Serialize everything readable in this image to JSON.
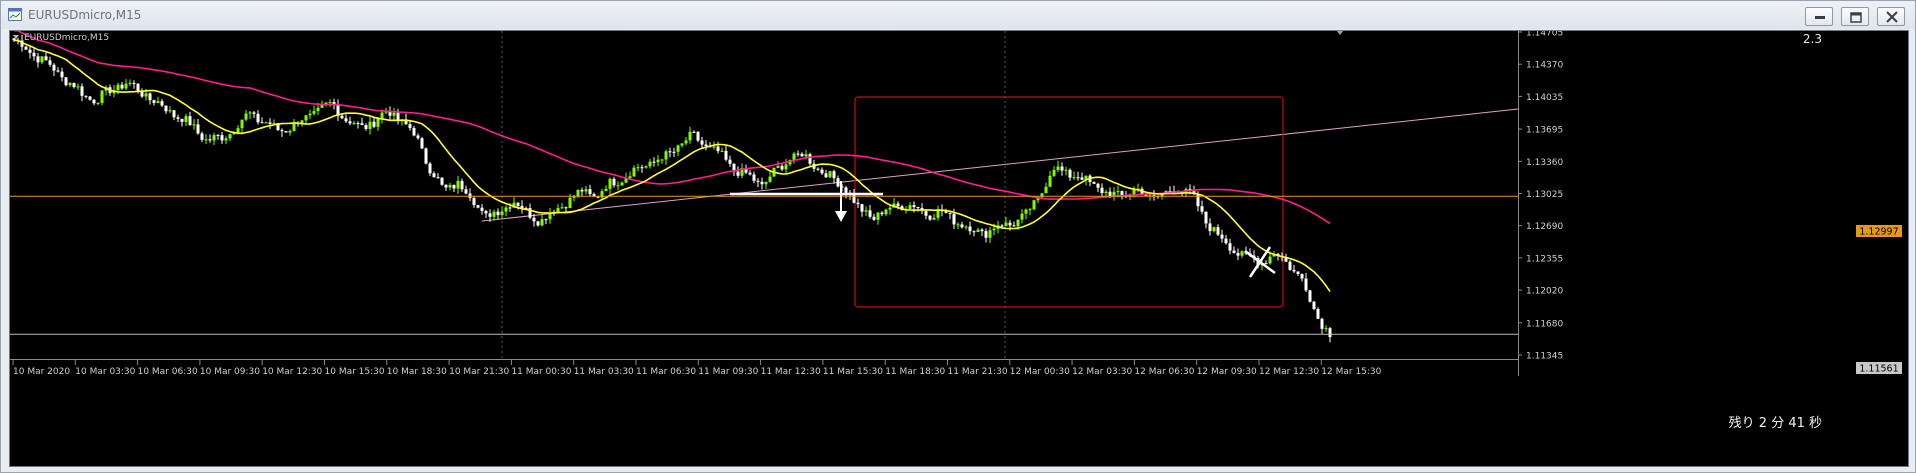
{
  "window": {
    "title": "EURUSDmicro,M15",
    "icon": "chart-window-icon"
  },
  "window_buttons": [
    {
      "name": "minimize-button",
      "icon": "minimize-icon"
    },
    {
      "name": "restore-button",
      "icon": "restore-icon"
    },
    {
      "name": "close-button",
      "icon": "close-icon"
    }
  ],
  "chart": {
    "symbol_label": "EURUSDmicro,M15",
    "corner_value": "2.3",
    "countdown": "残り 2 分 41 秒",
    "price_line_label": "1.12997",
    "bid_line_label": "1.11561",
    "colors": {
      "background": "#000000",
      "bull": "#7CFC00",
      "bear": "#FFFFFF",
      "ma_fast": "#FFFF33",
      "ma_slow": "#FF1E8C",
      "price_line": "#E39A14",
      "box": "#C0101A"
    }
  },
  "chart_data": {
    "type": "candlestick",
    "yticks": [
      "1.14705",
      "1.14370",
      "1.14035",
      "1.13695",
      "1.13360",
      "1.13025",
      "1.12690",
      "1.12355",
      "1.12020",
      "1.11680",
      "1.11345"
    ],
    "ylim": [
      1.11345,
      1.14705
    ],
    "xticks": [
      "10 Mar 2020",
      "10 Mar 03:30",
      "10 Mar 06:30",
      "10 Mar 09:30",
      "10 Mar 12:30",
      "10 Mar 15:30",
      "10 Mar 18:30",
      "10 Mar 21:30",
      "11 Mar 00:30",
      "11 Mar 03:30",
      "11 Mar 06:30",
      "11 Mar 09:30",
      "11 Mar 12:30",
      "11 Mar 15:30",
      "11 Mar 18:30",
      "11 Mar 21:30",
      "12 Mar 00:30",
      "12 Mar 03:30",
      "12 Mar 06:30",
      "12 Mar 09:30",
      "12 Mar 12:30",
      "12 Mar 15:30"
    ],
    "horizontal_lines": [
      1.12997,
      1.11561
    ],
    "anchors": [
      1.1462,
      1.1452,
      1.1442,
      1.143,
      1.1418,
      1.1405,
      1.14,
      1.141,
      1.1418,
      1.141,
      1.14,
      1.139,
      1.1382,
      1.137,
      1.1358,
      1.136,
      1.1372,
      1.1385,
      1.1378,
      1.1368,
      1.1372,
      1.138,
      1.139,
      1.1395,
      1.138,
      1.137,
      1.1378,
      1.1388,
      1.1378,
      1.1362,
      1.133,
      1.1305,
      1.1315,
      1.1298,
      1.128,
      1.1282,
      1.1297,
      1.1282,
      1.1275,
      1.1284,
      1.1296,
      1.1304,
      1.13,
      1.1312,
      1.132,
      1.1328,
      1.1335,
      1.134,
      1.1352,
      1.1362,
      1.1352,
      1.1342,
      1.1328,
      1.132,
      1.1312,
      1.1325,
      1.134,
      1.1342,
      1.133,
      1.1318,
      1.131,
      1.1285,
      1.1278,
      1.1285,
      1.1292,
      1.1288,
      1.1282,
      1.1282,
      1.1275,
      1.1265,
      1.1262,
      1.1268,
      1.1272,
      1.1278,
      1.13,
      1.1328,
      1.1325,
      1.1318,
      1.1312,
      1.13,
      1.1302,
      1.1305,
      1.13,
      1.13,
      1.131,
      1.13,
      1.1275,
      1.1258,
      1.1245,
      1.1235,
      1.1232,
      1.124,
      1.123,
      1.1212,
      1.1178,
      1.1155
    ]
  }
}
